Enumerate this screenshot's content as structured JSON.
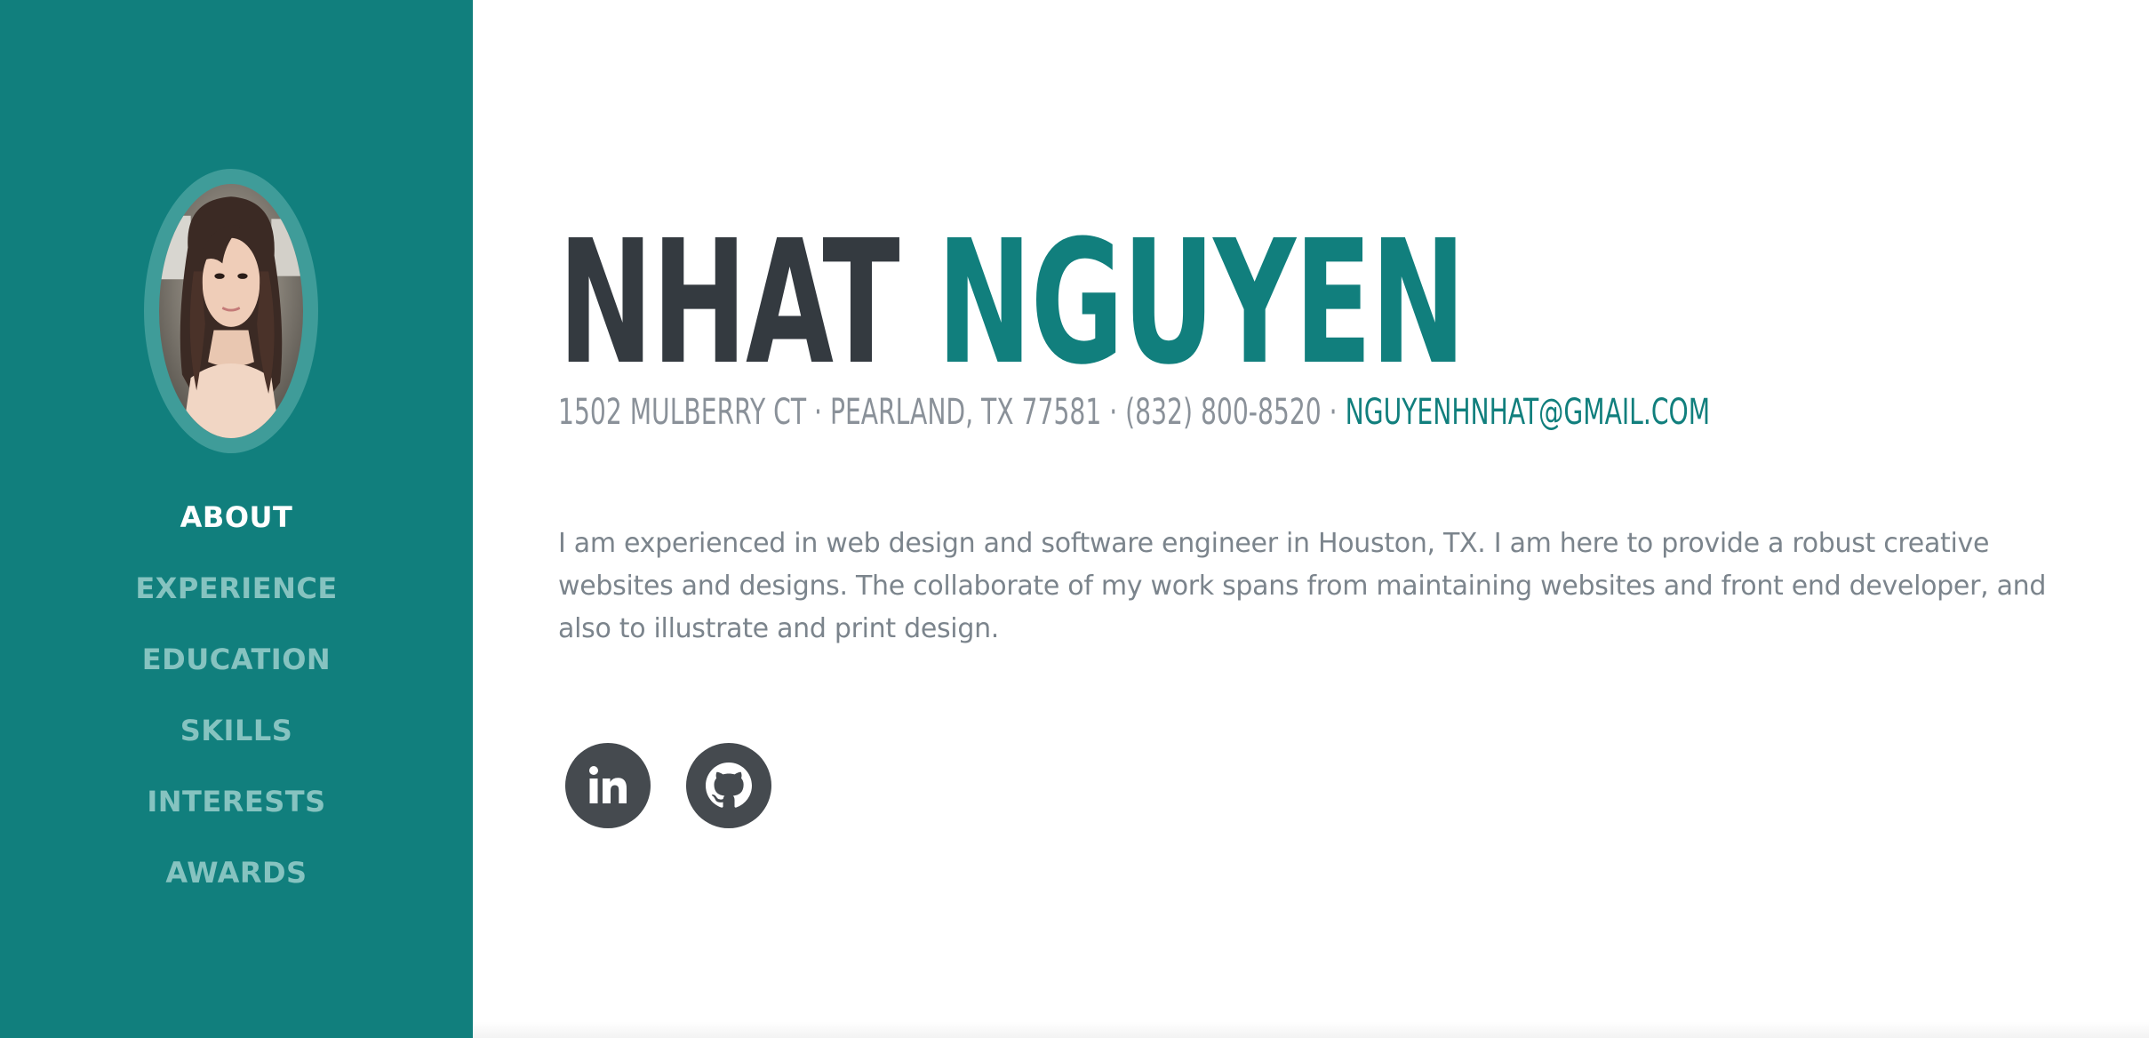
{
  "profile": {
    "first_name": "NHAT",
    "last_name": "NGUYEN",
    "address": "1502 MULBERRY CT · PEARLAND, TX 77581 · (832) 800-8520 ·",
    "email": "NGUYENHNHAT@GMAIL.COM",
    "bio": "I am experienced in web design and software engineer in Houston, TX. I am here to provide a robust creative websites and designs. The collaborate of my work spans from maintaining websites and front end developer, and also to illustrate and print design."
  },
  "sidebar": {
    "nav": [
      {
        "label": "ABOUT",
        "active": true
      },
      {
        "label": "EXPERIENCE",
        "active": false
      },
      {
        "label": "EDUCATION",
        "active": false
      },
      {
        "label": "SKILLS",
        "active": false
      },
      {
        "label": "INTERESTS",
        "active": false
      },
      {
        "label": "AWARDS",
        "active": false
      }
    ]
  },
  "social": [
    {
      "icon": "linkedin-icon"
    },
    {
      "icon": "github-icon"
    }
  ],
  "colors": {
    "primary": "#117f7d",
    "dark": "#343a40",
    "muted": "#8a9199",
    "nav_inactive": "#86c3c0",
    "social_bg": "#454a4f"
  }
}
